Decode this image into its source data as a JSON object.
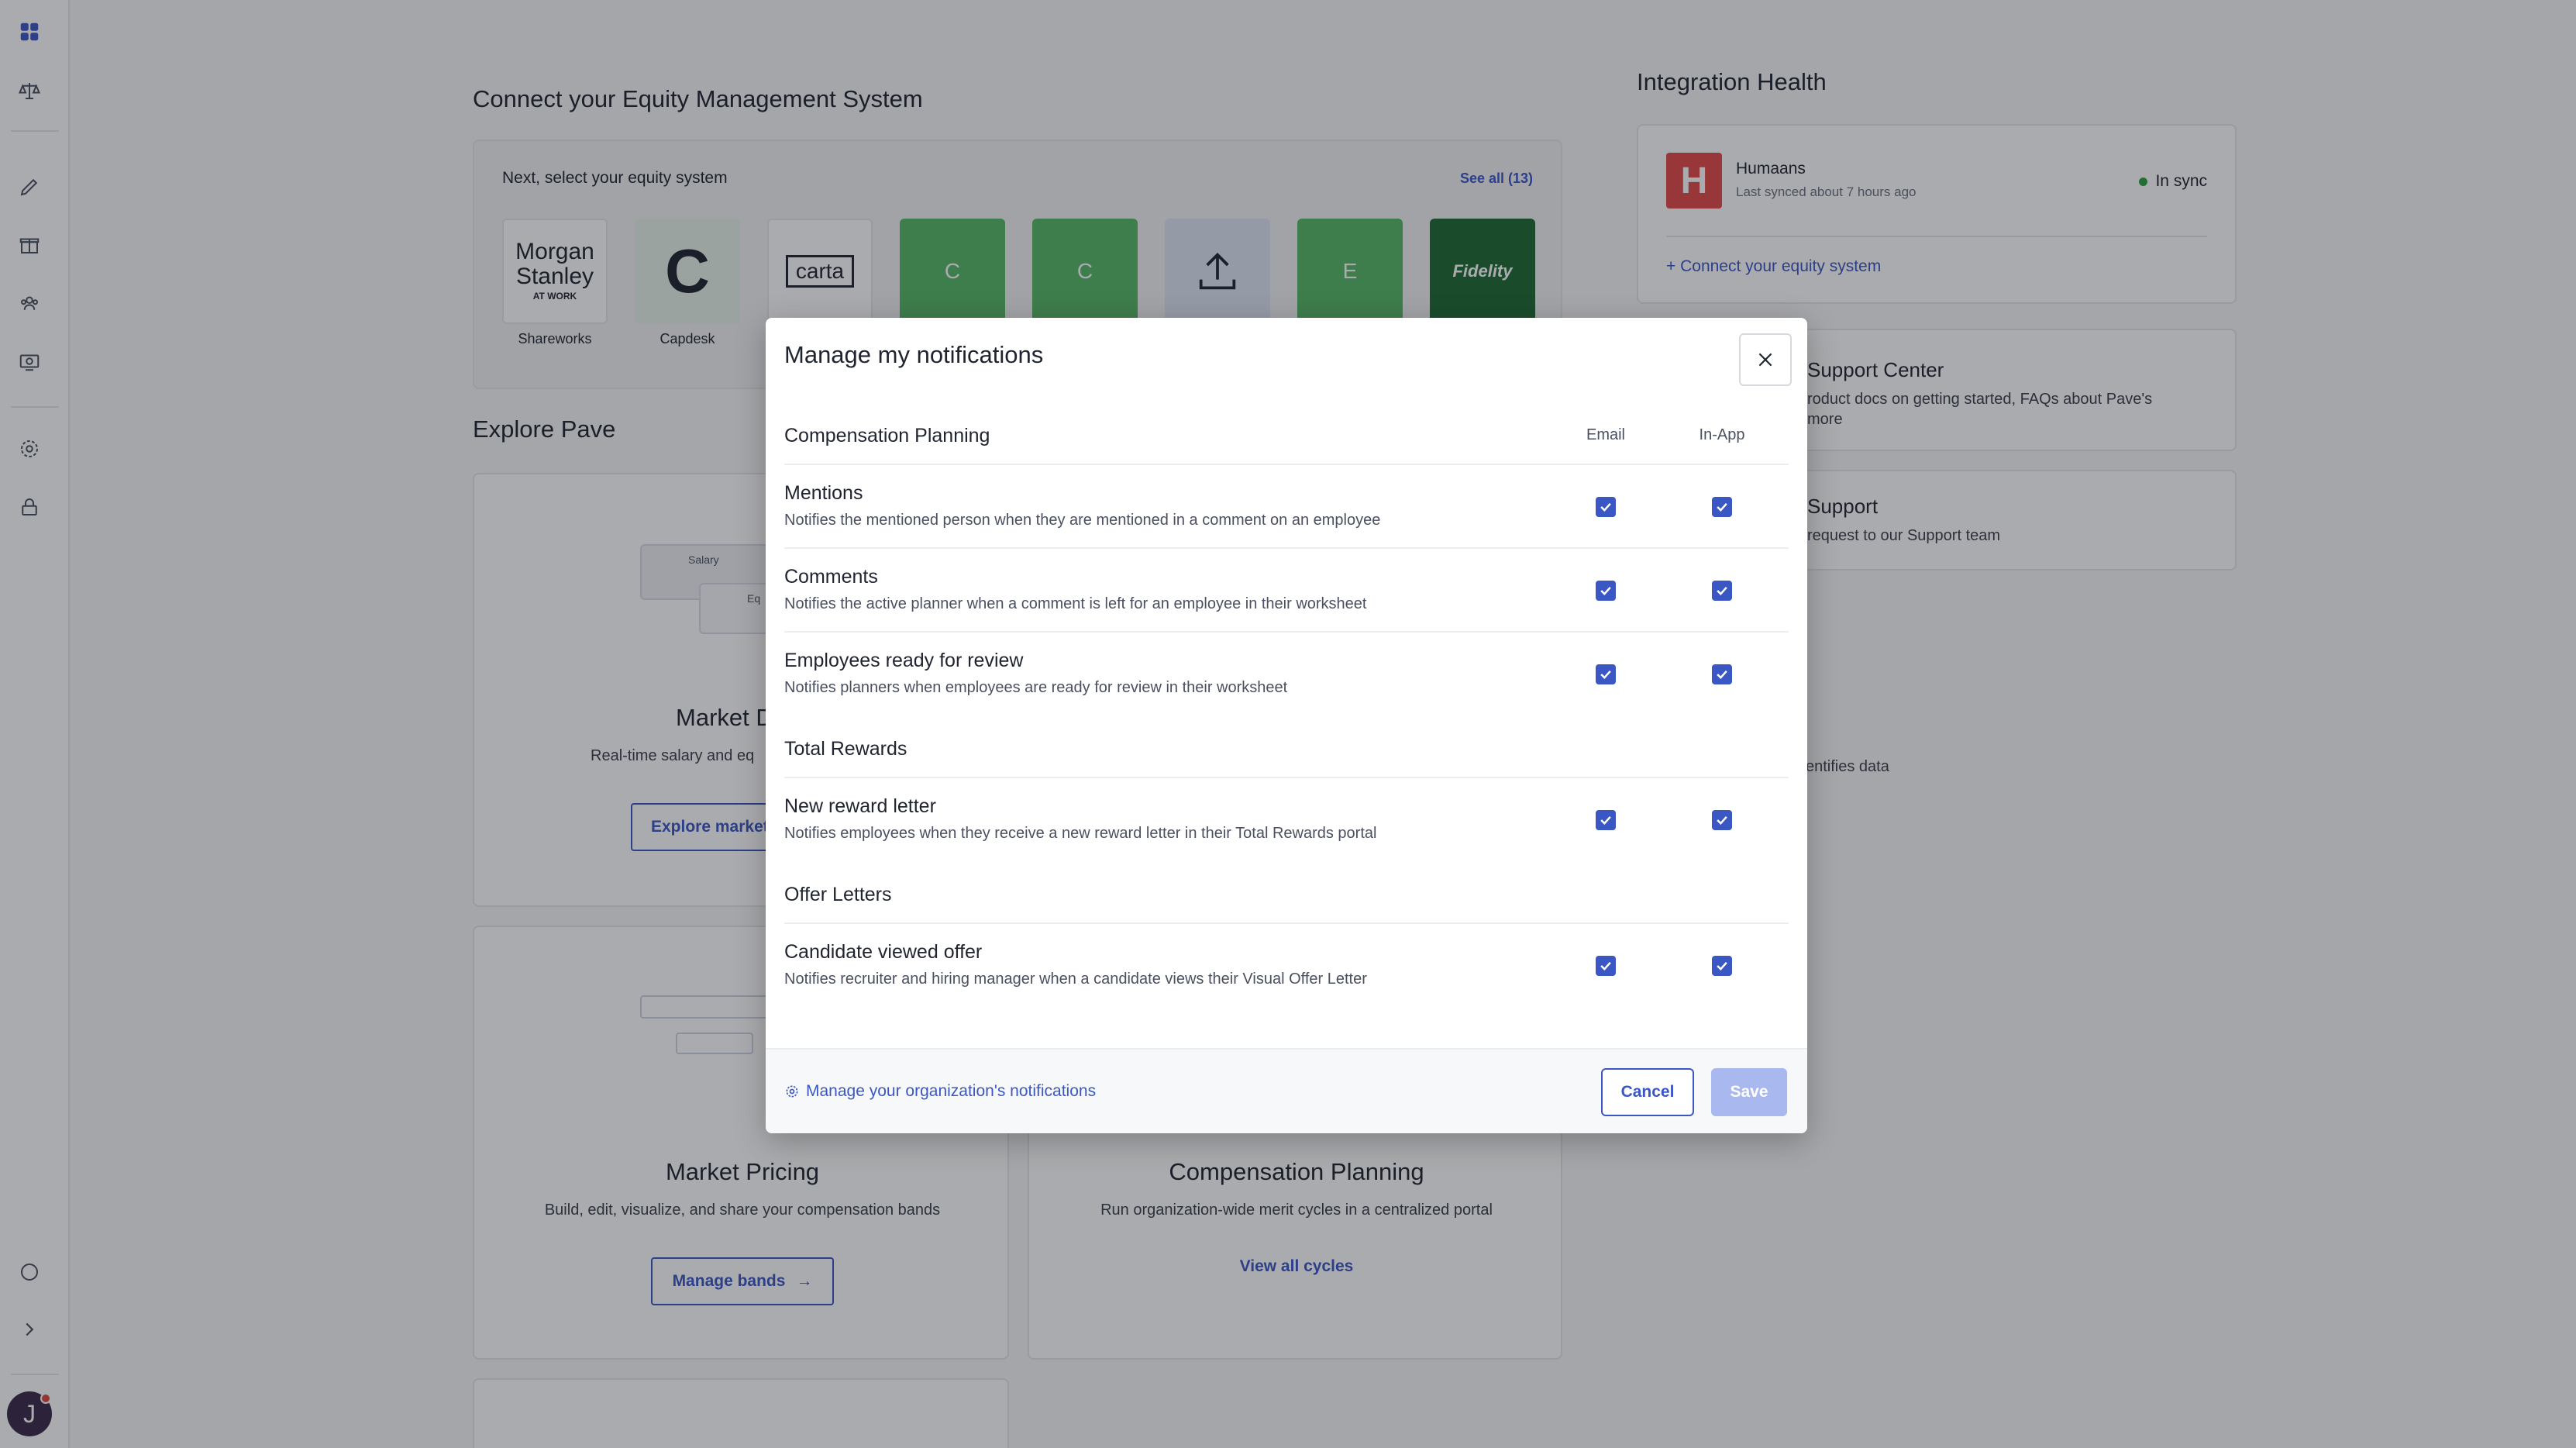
{
  "rail": {
    "icons": [
      "grid-icon",
      "scale-icon",
      "pencil-icon",
      "gift-icon",
      "people-icon",
      "money-icon",
      "gear-icon",
      "lock-icon",
      "chat-icon",
      "chevron-right-icon"
    ],
    "avatar_initial": "J"
  },
  "equity": {
    "title": "Connect your Equity Management System",
    "heading": "Next, select your equity system",
    "see_all": "See all (13)",
    "tiles": [
      {
        "label": "Shareworks",
        "logo": "Morgan Stanley",
        "logo_sub": "AT WORK"
      },
      {
        "label": "Capdesk",
        "logo": "C"
      },
      {
        "label": "",
        "logo": "carta"
      },
      {
        "label": "",
        "logo": "C"
      },
      {
        "label": "",
        "logo": "C"
      },
      {
        "label": "",
        "logo": "upload-icon"
      },
      {
        "label": "",
        "logo": "E"
      },
      {
        "label": "",
        "logo": "Fidelity"
      }
    ]
  },
  "integration": {
    "title": "Integration Health",
    "name": "Humaans",
    "synced": "Last synced about 7 hours ago",
    "status": "In sync",
    "connect": "+ Connect your equity system"
  },
  "side_cards": [
    {
      "title": "Support Center",
      "text": "roduct docs on getting started, FAQs about Pave's",
      "text2": "more"
    },
    {
      "title": "Support",
      "text": "request to our Support team"
    },
    {
      "text": "entifies data"
    }
  ],
  "explore": {
    "title": "Explore Pave",
    "market_data_title": "Market D",
    "market_data_desc": "Real-time salary and eq",
    "market_data_btn": "Explore market",
    "market_pricing_title": "Market Pricing",
    "market_pricing_desc": "Build, edit, visualize, and share your compensation bands",
    "market_pricing_btn": "Manage bands",
    "comp_planning_title": "Compensation Planning",
    "comp_planning_desc": "Run organization-wide merit cycles in a centralized portal",
    "comp_planning_link": "View all cycles",
    "mini_salary": "Salary",
    "mini_eq": "Eq"
  },
  "modal": {
    "title": "Manage my notifications",
    "col_email": "Email",
    "col_inapp": "In-App",
    "groups": [
      {
        "title": "Compensation Planning",
        "items": [
          {
            "title": "Mentions",
            "desc": "Notifies the mentioned person when they are mentioned in a comment on an employee",
            "email": true,
            "inapp": true
          },
          {
            "title": "Comments",
            "desc": "Notifies the active planner when a comment is left for an employee in their worksheet",
            "email": true,
            "inapp": true
          },
          {
            "title": "Employees ready for review",
            "desc": "Notifies planners when employees are ready for review in their worksheet",
            "email": true,
            "inapp": true
          }
        ]
      },
      {
        "title": "Total Rewards",
        "items": [
          {
            "title": "New reward letter",
            "desc": "Notifies employees when they receive a new reward letter in their Total Rewards portal",
            "email": true,
            "inapp": true
          }
        ]
      },
      {
        "title": "Offer Letters",
        "items": [
          {
            "title": "Candidate viewed offer",
            "desc": "Notifies recruiter and hiring manager when a candidate views their Visual Offer Letter",
            "email": true,
            "inapp": true
          }
        ]
      }
    ],
    "org_link": "Manage your organization's notifications",
    "cancel": "Cancel",
    "save": "Save",
    "colors": {
      "accent": "#3b57c4",
      "save_disabled": "#a9b8ef"
    }
  }
}
